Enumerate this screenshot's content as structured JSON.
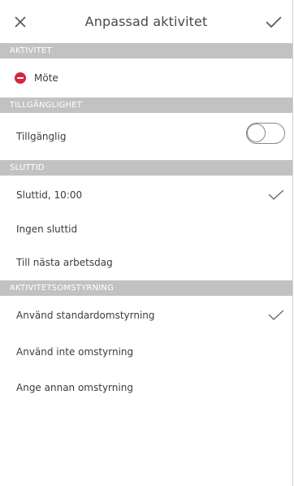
{
  "header": {
    "title": "Anpassad aktivitet"
  },
  "sections": {
    "activity": {
      "header": "AKTIVITET",
      "item_label": "Möte",
      "status_color": "#d6263c"
    },
    "availability": {
      "header": "TILLGÄNGLIGHET",
      "item_label": "Tillgänglig",
      "toggle_on": false
    },
    "end_time": {
      "header": "SLUTTID",
      "items": [
        {
          "label": "Sluttid,  10:00",
          "selected": true
        },
        {
          "label": "Ingen sluttid",
          "selected": false
        },
        {
          "label": "Till nästa arbetsdag",
          "selected": false
        }
      ]
    },
    "diversion": {
      "header": "AKTIVITETSOMSTYRNING",
      "items": [
        {
          "label": "Använd standardomstyrning",
          "selected": true
        },
        {
          "label": "Använd inte omstyrning",
          "selected": false
        },
        {
          "label": "Ange annan omstyrning",
          "selected": false
        }
      ]
    }
  },
  "icons": {
    "close": "close-icon",
    "confirm": "check-icon",
    "selected": "check-icon",
    "status": "do-not-disturb-icon"
  },
  "colors": {
    "section_header_bg": "#c2c2c2",
    "status_busy": "#d6263c",
    "text": "#3c3c3c"
  }
}
